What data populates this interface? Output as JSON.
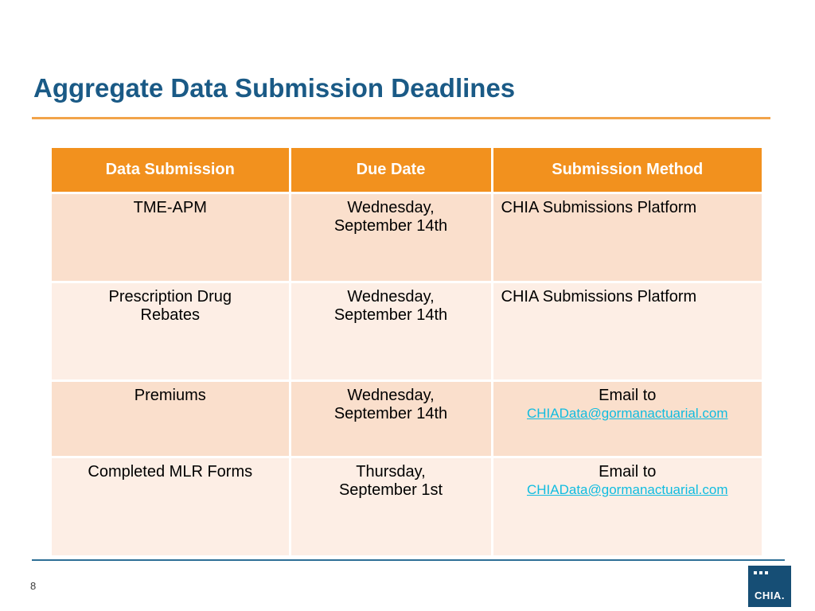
{
  "slide": {
    "title": "Aggregate Data Submission Deadlines",
    "page_number": "8",
    "accent_orange": "#f2911e",
    "title_color": "#1a5a86",
    "link_color": "#10bce0",
    "row_shade_odd": "#fadfcc",
    "row_shade_even": "#fdeee5"
  },
  "table": {
    "headers": [
      "Data Submission",
      "Due Date",
      "Submission Method"
    ],
    "rows": [
      {
        "submission": "TME-APM",
        "due_date_line1": "Wednesday,",
        "due_date_line2": "September 14th",
        "method": "CHIA Submissions Platform",
        "method_email": ""
      },
      {
        "submission_line1": "Prescription Drug",
        "submission_line2": "Rebates",
        "due_date_line1": "Wednesday,",
        "due_date_line2": "September 14th",
        "method": "CHIA Submissions Platform",
        "method_email": ""
      },
      {
        "submission": "Premiums",
        "due_date_line1": "Wednesday,",
        "due_date_line2": "September 14th",
        "method": "Email to",
        "method_email": "CHIAData@gormanactuarial.com"
      },
      {
        "submission": "Completed MLR Forms",
        "due_date_line1": "Thursday,",
        "due_date_line2": "September 1st",
        "method": "Email to",
        "method_email": "CHIAData@gormanactuarial.com"
      }
    ]
  },
  "logo": {
    "wordmark": "CHIA."
  }
}
